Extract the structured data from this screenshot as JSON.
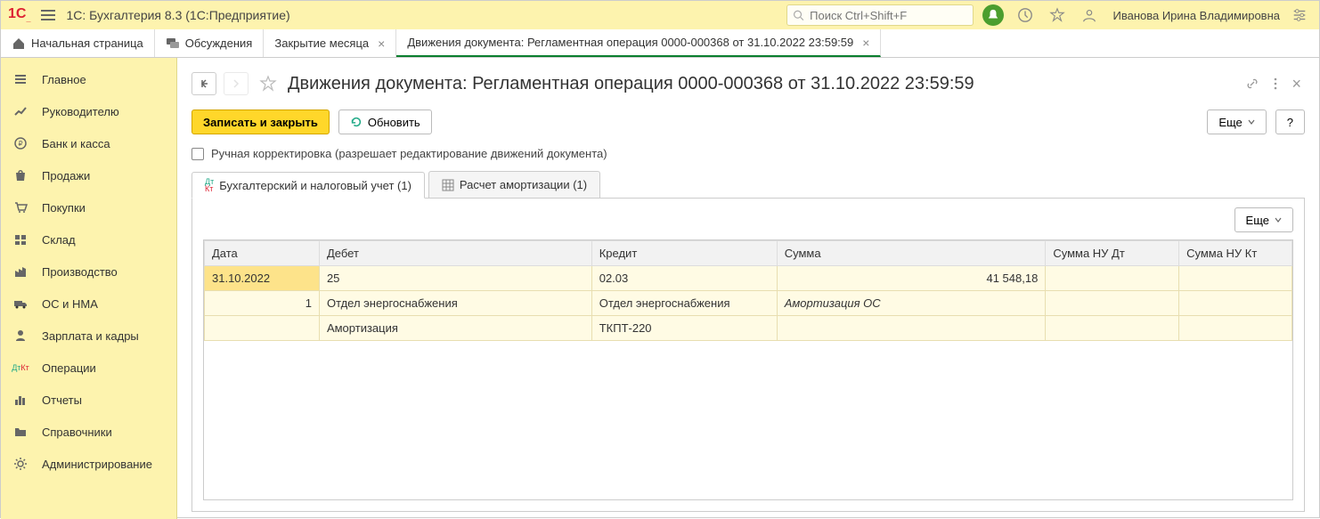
{
  "app": {
    "logo_text": "1С",
    "title": "1С: Бухгалтерия 8.3  (1С:Предприятие)",
    "search_placeholder": "Поиск Ctrl+Shift+F",
    "user_name": "Иванова Ирина Владимировна"
  },
  "tabs": {
    "home": "Начальная страница",
    "items": [
      {
        "label": "Обсуждения",
        "closable": false
      },
      {
        "label": "Закрытие месяца",
        "closable": true
      },
      {
        "label": "Движения документа: Регламентная операция 0000-000368 от 31.10.2022 23:59:59",
        "closable": true,
        "active": true
      }
    ]
  },
  "sidebar": {
    "items": [
      {
        "label": "Главное"
      },
      {
        "label": "Руководителю"
      },
      {
        "label": "Банк и касса"
      },
      {
        "label": "Продажи"
      },
      {
        "label": "Покупки"
      },
      {
        "label": "Склад"
      },
      {
        "label": "Производство"
      },
      {
        "label": "ОС и НМА"
      },
      {
        "label": "Зарплата и кадры"
      },
      {
        "label": "Операции"
      },
      {
        "label": "Отчеты"
      },
      {
        "label": "Справочники"
      },
      {
        "label": "Администрирование"
      }
    ]
  },
  "page": {
    "title": "Движения документа: Регламентная операция 0000-000368 от 31.10.2022 23:59:59",
    "save_close_label": "Записать и закрыть",
    "refresh_label": "Обновить",
    "more_label": "Еще",
    "help_label": "?",
    "manual_adjust_label": "Ручная корректировка (разрешает редактирование движений документа)"
  },
  "doc_tabs": {
    "items": [
      {
        "label": "Бухгалтерский и налоговый учет (1)",
        "active": true
      },
      {
        "label": "Расчет амортизации (1)",
        "active": false
      }
    ]
  },
  "table": {
    "headers": {
      "date": "Дата",
      "debit": "Дебет",
      "credit": "Кредит",
      "sum": "Сумма",
      "sum_nu_dt": "Сумма НУ Дт",
      "sum_nu_kt": "Сумма НУ Кт"
    },
    "rows": [
      {
        "date": "31.10.2022",
        "row_num": "1",
        "debit_acct": "25",
        "credit_acct": "02.03",
        "sum": "41 548,18",
        "debit_sub1": "Отдел энергоснабжения",
        "debit_sub2": "Амортизация",
        "credit_sub1": "Отдел энергоснабжения",
        "credit_sub2": "ТКПТ-220",
        "sum_note": "Амортизация ОС"
      }
    ],
    "more_label": "Еще"
  }
}
